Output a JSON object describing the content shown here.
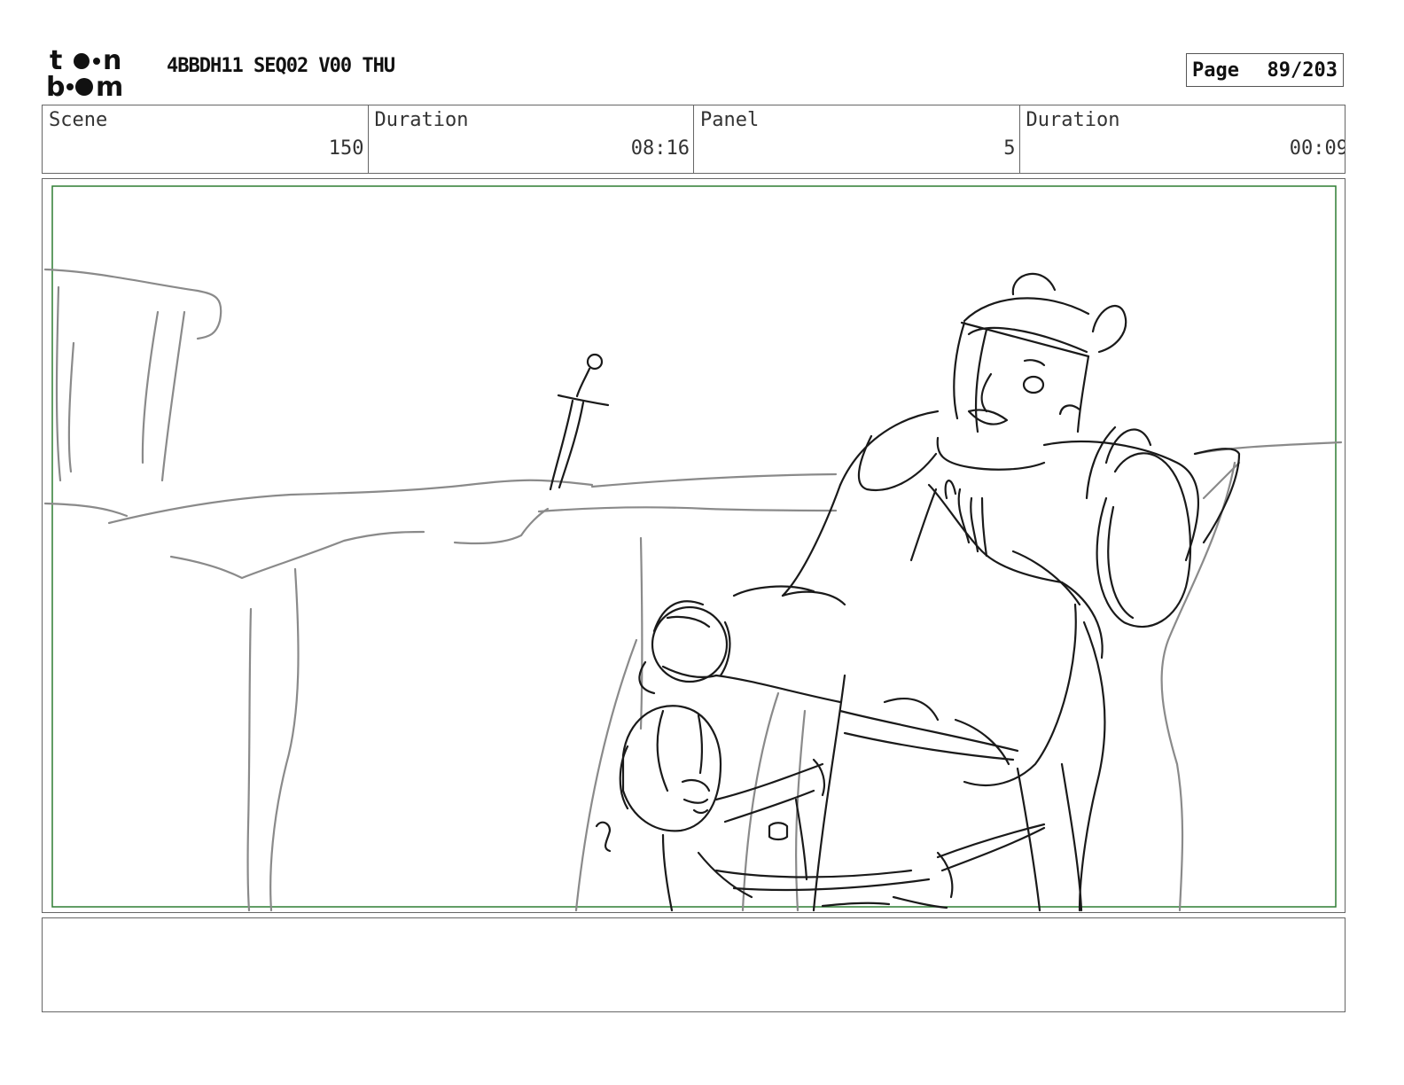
{
  "header": {
    "logo_text": "toonboom",
    "title": "4BBDH11 SEQ02 V00 THU",
    "page_label": "Page",
    "page_value": "89/203"
  },
  "info": {
    "scene_label": "Scene",
    "scene_value": "150",
    "duration_label": "Duration",
    "duration_value": "08:16",
    "panel_label": "Panel",
    "panel_value": "5",
    "panel_duration_label": "Duration",
    "panel_duration_value": "00:09"
  },
  "notes": {
    "text": ""
  },
  "colors": {
    "safe_frame": "#2e7d32",
    "sketch_ink": "#1a1a1a",
    "background_pencil": "#8a8a8a",
    "border": "#666666"
  }
}
